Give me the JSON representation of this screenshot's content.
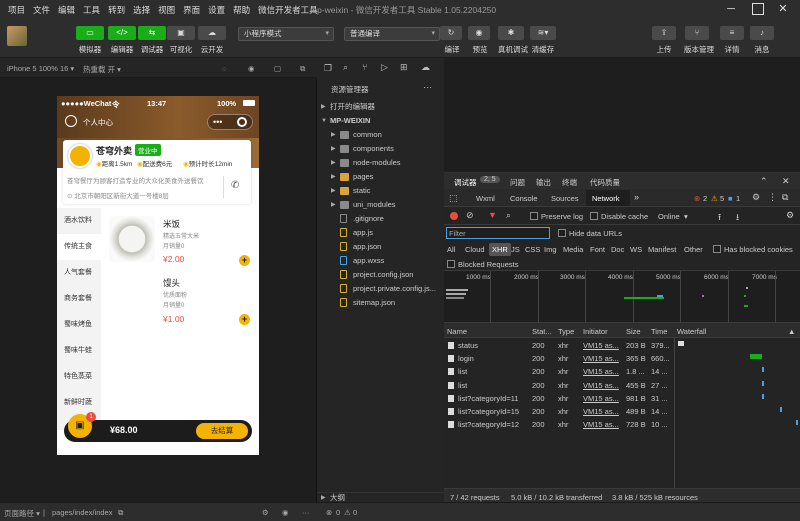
{
  "menu": [
    "项目",
    "文件",
    "编辑",
    "工具",
    "转到",
    "选择",
    "视图",
    "界面",
    "设置",
    "帮助",
    "微信开发者工具"
  ],
  "window_title": "mp-weixin - 微信开发者工具 Stable 1.05.2204250",
  "toolbar": {
    "left_buttons": [
      "模拟器",
      "编辑器",
      "调试器",
      "可视化",
      "云开发"
    ],
    "mode_select": "小程序模式",
    "compile_select": "普通编译",
    "mid_buttons": [
      "编译",
      "预览",
      "真机调试",
      "清缓存"
    ],
    "right_buttons": [
      "上传",
      "版本管理",
      "详情",
      "消息"
    ]
  },
  "sim_header": {
    "device": "iPhone 5 100% 16 ▾",
    "hot_reload": "热重载 开 ▾"
  },
  "phone": {
    "carrier": "●●●●●WeChat",
    "wifi": "令",
    "time": "13:47",
    "battery": "100%",
    "user_center": "个人中心",
    "shop_name": "苍穹外卖",
    "shop_status": "营业中",
    "distance": "距离1.5km",
    "delivery_fee": "配送费6元",
    "eta": "预计时长12min",
    "shop_desc": "苍穹餐厅为顾客打造专业的大众化美食外送餐饮",
    "address": "北京市朝阳区新街大道一号楼8层",
    "categories": [
      "酒水饮料",
      "传统主食",
      "人气套餐",
      "商务套餐",
      "蜀味烤鱼",
      "蜀味牛蛙",
      "特色蒸菜",
      "新鲜时蔬"
    ],
    "active_category": 1,
    "dishes": [
      {
        "name": "米饭",
        "desc": "精选五常大米",
        "sales": "月销量0",
        "price": "¥2.00"
      },
      {
        "name": "馒头",
        "desc": "优质面粉",
        "sales": "月销量0",
        "price": "¥1.00"
      }
    ],
    "cart_count": "1",
    "cart_total": "¥68.00",
    "checkout": "去结算"
  },
  "explorer": {
    "title": "资源管理器",
    "open_editors": "打开的编辑器",
    "project": "MP-WEIXIN",
    "folders": [
      "common",
      "components",
      "node-modules",
      "pages",
      "static",
      "uni_modules"
    ],
    "files": [
      ".gitignore",
      "app.js",
      "app.json",
      "app.wxss",
      "project.config.json",
      "project.private.config.js...",
      "sitemap.json"
    ],
    "outline": "大纲"
  },
  "devtools": {
    "top_tabs": [
      "调试器",
      "2, 5",
      "问题",
      "输出",
      "终端",
      "代码质量"
    ],
    "panel_tabs": [
      "Wxml",
      "Console",
      "Sources",
      "Network"
    ],
    "active_panel": "Network",
    "errors": "2",
    "warnings": "5",
    "info": "1",
    "preserve_log": "Preserve log",
    "disable_cache": "Disable cache",
    "throttle": "Online",
    "filter_placeholder": "Filter",
    "hide_data_urls": "Hide data URLs",
    "type_filters": [
      "All",
      "Cloud",
      "XHR",
      "JS",
      "CSS",
      "Img",
      "Media",
      "Font",
      "Doc",
      "WS",
      "Manifest",
      "Other"
    ],
    "has_blocked_cookies": "Has blocked cookies",
    "blocked_requests": "Blocked Requests",
    "timeline_ticks": [
      "1000 ms",
      "2000 ms",
      "3000 ms",
      "4000 ms",
      "5000 ms",
      "6000 ms",
      "7000 ms"
    ],
    "columns": [
      "Name",
      "Stat...",
      "Type",
      "Initiator",
      "Size",
      "Time",
      "Waterfall"
    ],
    "rows": [
      {
        "name": "status",
        "status": "200",
        "type": "xhr",
        "initiator": "VM15 as...",
        "size": "203 B",
        "time": "379..."
      },
      {
        "name": "login",
        "status": "200",
        "type": "xhr",
        "initiator": "VM15 as...",
        "size": "365 B",
        "time": "660..."
      },
      {
        "name": "list",
        "status": "200",
        "type": "xhr",
        "initiator": "VM15 as...",
        "size": "1.8 ...",
        "time": "14 ..."
      },
      {
        "name": "list",
        "status": "200",
        "type": "xhr",
        "initiator": "VM15 as...",
        "size": "455 B",
        "time": "27 ..."
      },
      {
        "name": "list?categoryId=11",
        "status": "200",
        "type": "xhr",
        "initiator": "VM15 as...",
        "size": "981 B",
        "time": "31 ..."
      },
      {
        "name": "list?categoryId=15",
        "status": "200",
        "type": "xhr",
        "initiator": "VM15 as...",
        "size": "489 B",
        "time": "14 ..."
      },
      {
        "name": "list?categoryId=12",
        "status": "200",
        "type": "xhr",
        "initiator": "VM15 as...",
        "size": "728 B",
        "time": "10 ..."
      }
    ],
    "summary_requests": "7 / 42 requests",
    "summary_transferred": "5.0 kB / 10.2 kB transferred",
    "summary_resources": "3.8 kB / 525 kB resources"
  },
  "statusbar": {
    "path_label": "页面路径 ▾",
    "path": "pages/index/index",
    "errors": "0",
    "warnings": "0"
  },
  "colors": {
    "accent_green": "#1aad19",
    "shop_yellow": "#f5b301",
    "price_red": "#e94e3c"
  }
}
